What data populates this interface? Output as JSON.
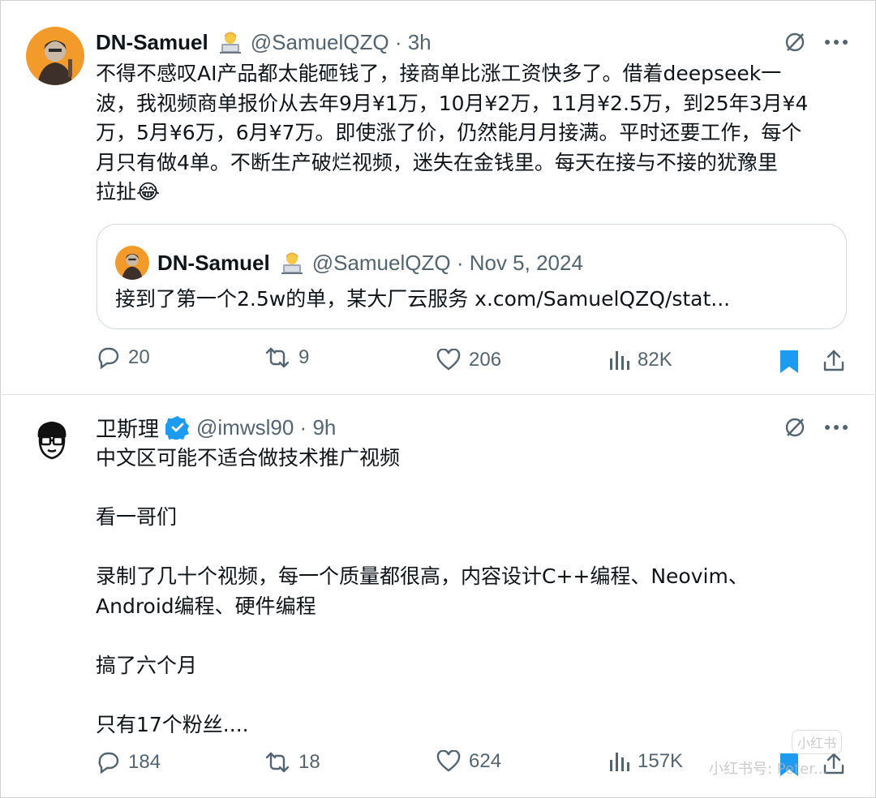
{
  "tweets": [
    {
      "display_name": "DN-Samuel",
      "handle": "@SamuelQZQ",
      "time": "3h",
      "text": "不得不感叹AI产品都太能砸钱了，接商单比涨工资快多了。借着deepseek一\n波，我视频商单报价从去年9月¥1万，10月¥2万，11月¥2.5万，到25年3月¥4\n万，5月¥6万，6月¥7万。即使涨了价，仍然能月月接满。平时还要工作，每个\n月只有做4单。不断生产破烂视频，迷失在金钱里。每天在接与不接的犹豫里\n拉扯😂",
      "quote": {
        "display_name": "DN-Samuel",
        "handle": "@SamuelQZQ",
        "date": "Nov 5, 2024",
        "text": "接到了第一个2.5w的单，某大厂云服务 x.com/SamuelQZQ/stat..."
      },
      "stats": {
        "replies": "20",
        "reposts": "9",
        "likes": "206",
        "views": "82K"
      },
      "bookmarked": true
    },
    {
      "display_name": "卫斯理",
      "handle": "@imwsl90",
      "time": "9h",
      "verified": true,
      "text": "中文区可能不适合做技术推广视频\n\n看一哥们\n\n录制了几十个视频，每一个质量都很高，内容设计C++编程、Neovim、\nAndroid编程、硬件编程\n\n搞了六个月\n\n只有17个粉丝....",
      "stats": {
        "replies": "184",
        "reposts": "18",
        "likes": "624",
        "views": "157K"
      },
      "bookmarked": true
    }
  ],
  "watermark": {
    "text1": "小红书",
    "text2": "小红书号: Peter..."
  },
  "colors": {
    "text": "#0f1419",
    "muted": "#536471",
    "accent": "#1d9bf0",
    "border": "#cfd9de"
  }
}
